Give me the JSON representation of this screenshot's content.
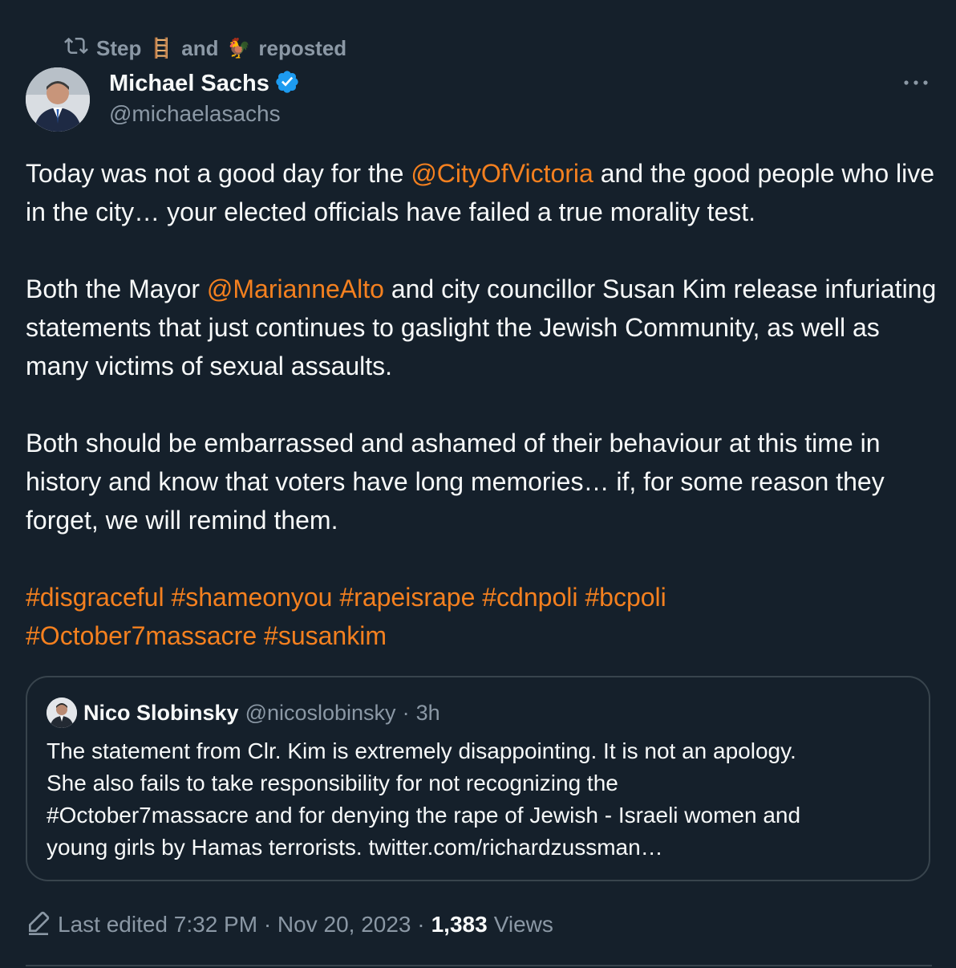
{
  "repost": {
    "prefix": "Step",
    "emoji1": "🪜",
    "middle": "and",
    "emoji2": "🐓",
    "suffix": "reposted"
  },
  "author": {
    "name": "Michael Sachs",
    "handle": "@michaelasachs",
    "verified": true
  },
  "tweet": {
    "p1_a": "Today was not a good day for the ",
    "p1_mention": "@CityOfVictoria",
    "p1_b": " and the good people who live in the city… your elected officials have failed a true morality test.",
    "p2_a": "Both the Mayor ",
    "p2_mention": "@MarianneAlto",
    "p2_b": " and city councillor Susan Kim release infuriating statements that just continues to gaslight the Jewish Community, as well as many victims of sexual assaults.",
    "p3": "Both should be embarrassed and ashamed of their behaviour at this time in history and know that voters have long memories… if, for some reason they forget, we will remind them.",
    "hashtags": [
      "#disgraceful",
      "#shameonyou",
      "#rapeisrape",
      "#cdnpoli",
      "#bcpoli",
      "#October7massacre",
      "#susankim"
    ]
  },
  "quote": {
    "name": "Nico Slobinsky",
    "handle": "@nicoslobinsky",
    "time": "3h",
    "line1": "The statement from Clr. Kim is extremely disappointing. It is not an apology.",
    "line2": "She also fails to take  responsibility for not recognizing the",
    "line3": "#October7massacre and for denying the rape of  Jewish - Israeli women and",
    "line4": "young girls by Hamas terrorists. twitter.com/richardzussman…"
  },
  "footer": {
    "edited": "Last edited 7:32 PM · Nov 20, 2023 ·",
    "views_count": "1,383",
    "views_label": "Views"
  },
  "colors": {
    "background": "#15202b",
    "accent": "#f4801f",
    "muted": "#8b98a5",
    "verified": "#1d9bf0",
    "border": "#38444d"
  }
}
